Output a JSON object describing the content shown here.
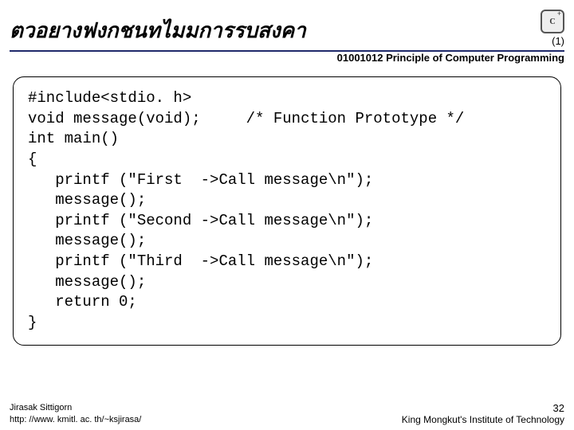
{
  "header": {
    "title": "ตวอยางฟงกชนทไมมการรบสงคา",
    "part": "(1)",
    "logo_text": "C",
    "course": "01001012 Principle of Computer Programming"
  },
  "code": {
    "line1": "#include<stdio. h>",
    "line2a": "void message(void);",
    "line2b": "/* Function Prototype */",
    "line3": "int main()",
    "line4": "{",
    "line5": "   printf (\"First  ->Call message\\n\");",
    "line6": "   message();",
    "line7": "   printf (\"Second ->Call message\\n\");",
    "line8": "   message();",
    "line9": "   printf (\"Third  ->Call message\\n\");",
    "line10": "   message();",
    "line11": "   return 0;",
    "line12": "}"
  },
  "footer": {
    "author": "Jirasak Sittigorn",
    "url": "http: //www. kmitl. ac. th/~ksjirasa/",
    "page": "32",
    "institute": "King Mongkut's Institute of Technology"
  }
}
